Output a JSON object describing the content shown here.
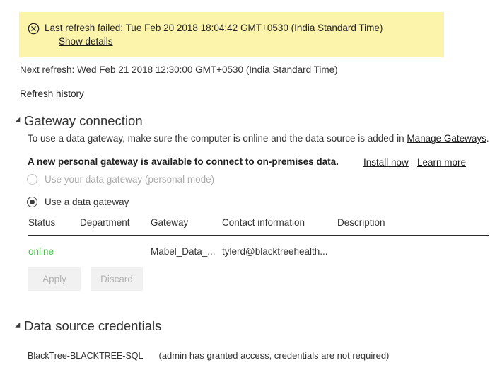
{
  "error_banner": {
    "icon": "error-circle-x-icon",
    "message": "Last refresh failed: Tue Feb 20 2018 18:04:42 GMT+0530 (India Standard Time)",
    "details_link": "Show details",
    "background_color": "#fcf4ab"
  },
  "refresh": {
    "next": "Next refresh: Wed Feb 21 2018 12:30:00 GMT+0530 (India Standard Time)",
    "history_link": "Refresh history"
  },
  "gateway_section": {
    "title": "Gateway connection",
    "expanded": true,
    "description_prefix": "To use a data gateway, make sure the computer is online and the data source is added in ",
    "description_link": "Manage Gateways",
    "description_suffix": ".",
    "promo_text": "A new personal gateway is available to connect to on-premises data.",
    "install_link": "Install now",
    "learn_link": "Learn more",
    "options": [
      {
        "label": "Use your data gateway (personal mode)",
        "selected": false,
        "disabled": true
      },
      {
        "label": "Use a data gateway",
        "selected": true,
        "disabled": false
      }
    ],
    "table": {
      "columns": [
        "Status",
        "Department",
        "Gateway",
        "Contact information",
        "Description"
      ],
      "rows": [
        {
          "status": "online",
          "status_color": "#4cc14c",
          "department": "",
          "gateway": "Mabel_Data_...",
          "contact": "tylerd@blacktreehealth...",
          "description": ""
        }
      ]
    },
    "buttons": {
      "apply": "Apply",
      "discard": "Discard"
    }
  },
  "credentials_section": {
    "title": "Data source credentials",
    "expanded": true,
    "entries": [
      {
        "name": "BlackTree-BLACKTREE-SQL",
        "note": "(admin has granted access, credentials are not required)"
      }
    ]
  }
}
